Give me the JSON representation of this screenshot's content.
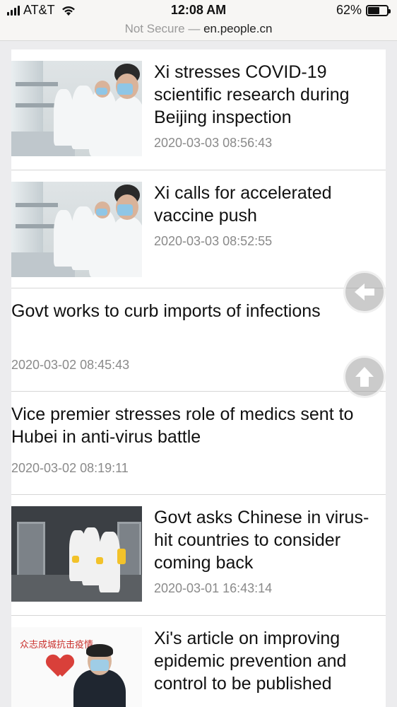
{
  "status_bar": {
    "carrier": "AT&T",
    "time": "12:08 AM",
    "battery_percent": "62%",
    "battery_level": 0.62,
    "icons": [
      "signal-icon",
      "wifi-icon",
      "battery-icon"
    ]
  },
  "url_bar": {
    "security": "Not Secure",
    "separator": " — ",
    "host": "en.people.cn"
  },
  "articles": [
    {
      "title": "Xi stresses COVID-19 scientific research during Beijing inspection",
      "date": "2020-03-03 08:56:43"
    },
    {
      "title": "Xi calls for accelerated vaccine push",
      "date": "2020-03-03 08:52:55"
    },
    {
      "title": "Govt works to curb imports of infections",
      "date": "2020-03-02 08:45:43"
    },
    {
      "title": "Vice premier stresses role of medics sent to Hubei in anti-virus battle",
      "date": "2020-03-02 08:19:11"
    },
    {
      "title": "Govt asks Chinese in virus-hit countries to consider coming back",
      "date": "2020-03-01 16:43:14"
    },
    {
      "title": "Xi's article on improving epidemic prevention and control to be published",
      "date": ""
    }
  ],
  "poster_text": "众志成城抗击疫情",
  "floating_buttons": {
    "back": "back-arrow-icon",
    "top": "up-arrow-icon"
  }
}
